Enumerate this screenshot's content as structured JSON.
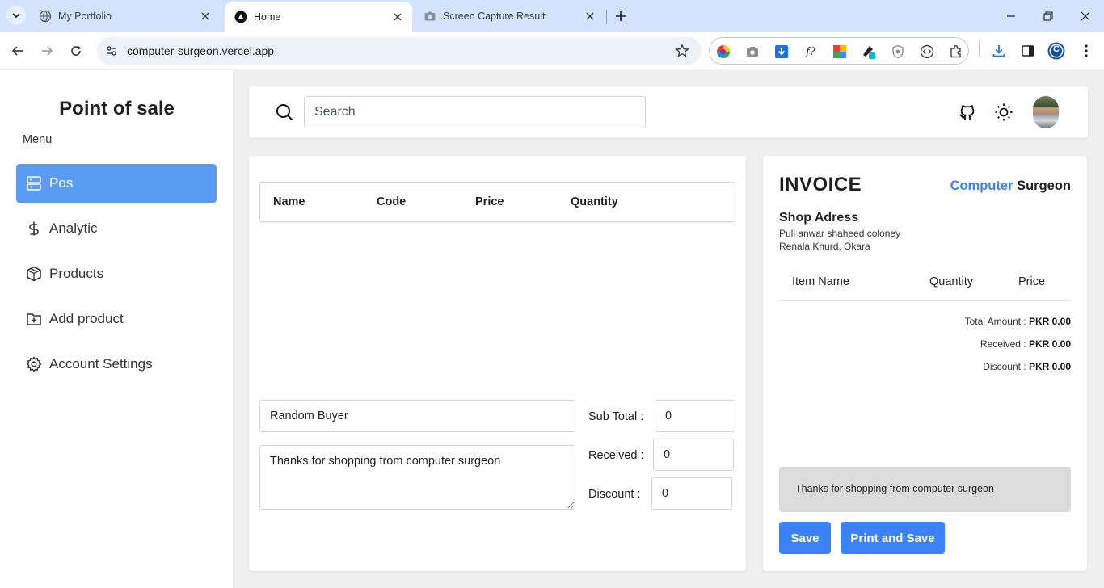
{
  "browser": {
    "tabs": [
      {
        "title": "My Portfolio",
        "active": false
      },
      {
        "title": "Home",
        "active": true
      },
      {
        "title": "Screen Capture Result",
        "active": false
      }
    ],
    "url": "computer-surgeon.vercel.app",
    "profile_initial": "C"
  },
  "sidebar": {
    "title": "Point of sale",
    "menu_label": "Menu",
    "items": [
      {
        "label": "Pos",
        "icon": "server-icon",
        "active": true
      },
      {
        "label": "Analytic",
        "icon": "dollar-icon",
        "active": false
      },
      {
        "label": "Products",
        "icon": "box-icon",
        "active": false
      },
      {
        "label": "Add product",
        "icon": "folder-plus-icon",
        "active": false
      },
      {
        "label": "Account Settings",
        "icon": "gear-icon",
        "active": false
      }
    ]
  },
  "header": {
    "search_placeholder": "Search"
  },
  "pos": {
    "columns": [
      "Name",
      "Code",
      "Price",
      "Quantity"
    ],
    "buyer_name": "Random Buyer",
    "note": "Thanks for shopping from computer surgeon",
    "sub_total_label": "Sub Total :",
    "sub_total_value": "0",
    "received_label": "Received :",
    "received_value": "0",
    "discount_label": "Discount :",
    "discount_value": "0"
  },
  "invoice": {
    "title": "INVOICE",
    "brand_part1": "Computer",
    "brand_part2": "Surgeon",
    "shop_title": "Shop Adress",
    "address_line1": "Pull anwar shaheed coloney",
    "address_line2": "Renala Khurd, Okara",
    "columns": [
      "Item Name",
      "Quantity",
      "Price"
    ],
    "total_amount_label": "Total Amount :",
    "total_amount_value": "PKR 0.00",
    "received_label": "Received :",
    "received_value": "PKR 0.00",
    "discount_label": "Discount :",
    "discount_value": "PKR 0.00",
    "note": "Thanks for shopping from computer surgeon",
    "save_label": "Save",
    "print_save_label": "Print and Save"
  },
  "colors": {
    "accent": "#3b82f6",
    "nav_active": "#5b9cf3",
    "tabbar": "#d3e3fd"
  }
}
